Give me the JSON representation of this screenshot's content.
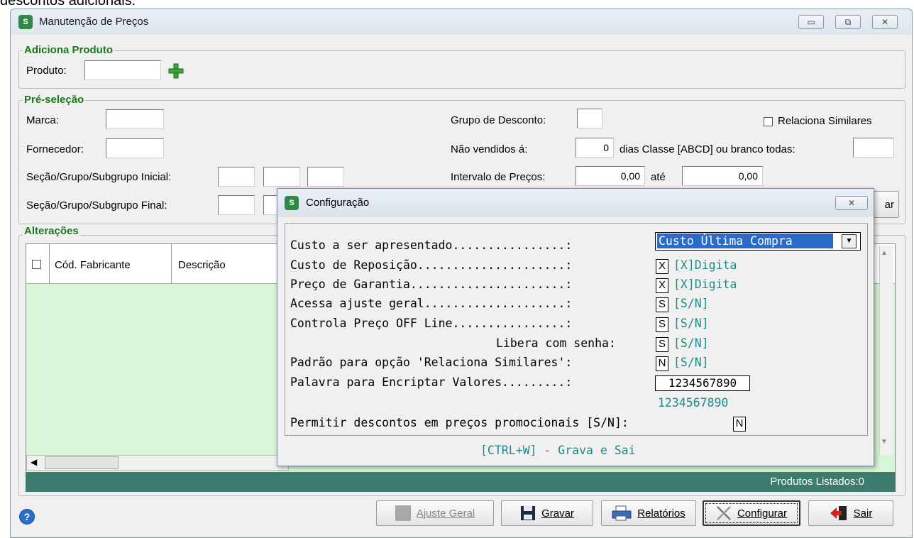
{
  "topline_text": "descontos adicionais.",
  "window": {
    "title": "Manutenção de Preços",
    "app_icon_text": "S",
    "caption_buttons": [
      "▭",
      "⧉",
      "✕"
    ]
  },
  "adiciona": {
    "group_title": "Adiciona Produto",
    "produto_label": "Produto:",
    "produto_value": ""
  },
  "preselecao": {
    "group_title": "Pré-seleção",
    "marca_label": "Marca:",
    "fornecedor_label": "Fornecedor:",
    "secao_inicial_label": "Seção/Grupo/Subgrupo Inicial:",
    "secao_final_label": "Seção/Grupo/Subgrupo Final:",
    "grupo_desconto_label": "Grupo de Desconto:",
    "nao_vendidos_label": "Não vendidos á:",
    "nao_vendidos_value": "0",
    "dias_classe_label": "dias Classe [ABCD] ou branco todas:",
    "intervalo_label": "Intervalo de Preços:",
    "intervalo_de": "0,00",
    "ate_label": "até",
    "intervalo_ate": "0,00",
    "relaciona_label": "Relaciona Similares",
    "hidden_button_tail": "ar"
  },
  "alteracoes": {
    "group_title": "Alterações",
    "columns": [
      "Cód. Fabricante",
      "Descrição"
    ],
    "status": "Produtos Listados:0"
  },
  "buttons": {
    "ajuste": "Ajuste Geral",
    "gravar": "Gravar",
    "relatorios": "Relatórios",
    "configurar": "Configurar",
    "sair": "Sair"
  },
  "dialog": {
    "title": "Configuração",
    "close": "✕",
    "rows": [
      {
        "label": "Custo a ser apresentado................:",
        "value": "Custo Última Compra",
        "hint": ""
      },
      {
        "label": "Custo de Reposição.....................:",
        "value": "X",
        "hint": "[X]Digita"
      },
      {
        "label": "Preço de Garantia......................:",
        "value": "X",
        "hint": "[X]Digita"
      },
      {
        "label": "Acessa ajuste geral....................:",
        "value": "S",
        "hint": "[S/N]"
      },
      {
        "label": "Controla Preço OFF Line................:",
        "value": "S",
        "hint": "[S/N]"
      },
      {
        "label": "Libera com senha:",
        "value": "S",
        "hint": "[S/N]"
      },
      {
        "label": "Padrão para opção 'Relaciona Similares':",
        "value": "N",
        "hint": "[S/N]"
      },
      {
        "label": "Palavra para Encriptar Valores.........:",
        "value": "1234567890",
        "hint": ""
      },
      {
        "label": "",
        "value": "",
        "hint": "1234567890"
      },
      {
        "label": "Permitir descontos em preços promocionais [S/N]:",
        "value": "N",
        "hint": ""
      }
    ],
    "footer": "[CTRL+W] - Grava e Sai"
  },
  "colors": {
    "group_title": "#1a7a1a",
    "status_bar": "#3d7b6e",
    "grid_bg": "#d7f5d7",
    "hint_teal": "#1f8a8a"
  }
}
